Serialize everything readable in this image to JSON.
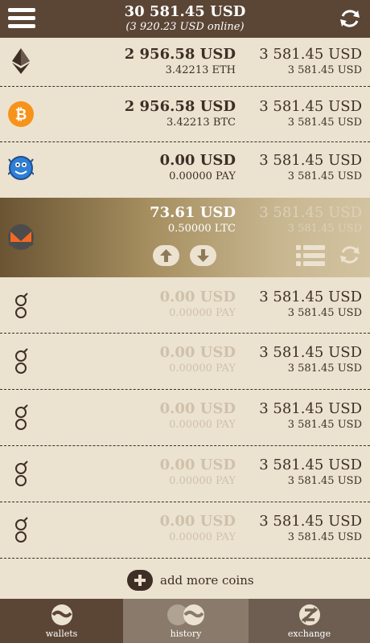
{
  "header": {
    "total": "30 581.45 USD",
    "online": "(3 920.23 USD online)"
  },
  "wallets": [
    {
      "icon": "ethereum-icon",
      "usd": "2 956.58 USD",
      "amount": "3.42213 ETH",
      "price_usd": "3 581.45 USD",
      "price_sub": "3 581.45 USD"
    },
    {
      "icon": "bitcoin-icon",
      "usd": "2 956.58 USD",
      "amount": "3.42213 BTC",
      "price_usd": "3 581.45 USD",
      "price_sub": "3 581.45 USD"
    },
    {
      "icon": "tenx-pay-icon",
      "usd": "0.00 USD",
      "amount": "0.00000 PAY",
      "price_usd": "3 581.45 USD",
      "price_sub": "3 581.45 USD"
    },
    {
      "icon": "monero-icon",
      "usd": "73.61 USD",
      "amount": "0.50000 LTC",
      "price_usd": "3 581.45 USD",
      "price_sub": "3 581.45 USD"
    },
    {
      "icon": "golem-icon",
      "usd": "0.00 USD",
      "amount": "0.00000 PAY",
      "price_usd": "3 581.45 USD",
      "price_sub": "3 581.45 USD"
    },
    {
      "icon": "golem-icon",
      "usd": "0.00 USD",
      "amount": "0.00000 PAY",
      "price_usd": "3 581.45 USD",
      "price_sub": "3 581.45 USD"
    },
    {
      "icon": "golem-icon",
      "usd": "0.00 USD",
      "amount": "0.00000 PAY",
      "price_usd": "3 581.45 USD",
      "price_sub": "3 581.45 USD"
    },
    {
      "icon": "golem-icon",
      "usd": "0.00 USD",
      "amount": "0.00000 PAY",
      "price_usd": "3 581.45 USD",
      "price_sub": "3 581.45 USD"
    },
    {
      "icon": "golem-icon",
      "usd": "0.00 USD",
      "amount": "0.00000 PAY",
      "price_usd": "3 581.45 USD",
      "price_sub": "3 581.45 USD"
    }
  ],
  "add_more": "add more coins",
  "tabs": [
    {
      "label": "wallets",
      "active": true
    },
    {
      "label": "history",
      "active": false
    },
    {
      "label": "exchange",
      "active": false
    }
  ],
  "colors": {
    "header_bg": "#5b4535",
    "page_bg": "#ece2d0",
    "text": "#3d2f25",
    "faded_text": "#cfc1aa",
    "bitcoin": "#f7931a",
    "monero": "#f26822",
    "tab_wallets": "#5b4535",
    "tab_history": "#8a7a6b",
    "tab_exchange": "#6e5e52"
  }
}
